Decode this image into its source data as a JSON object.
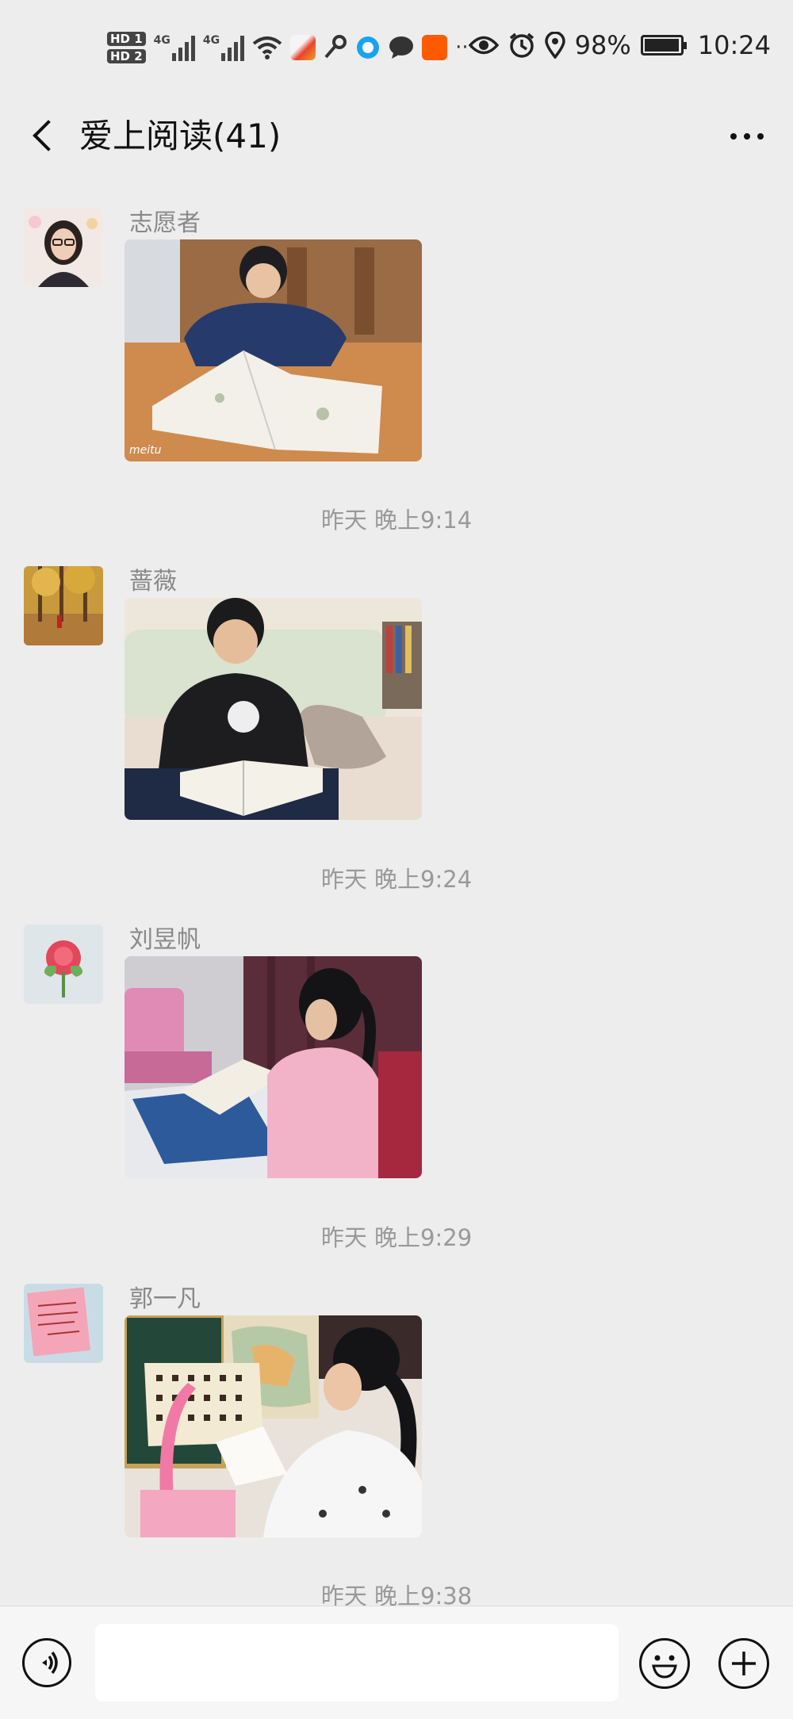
{
  "status": {
    "sim_labels": [
      "HD 1",
      "HD 2"
    ],
    "net_labels": [
      "4G",
      "4G"
    ],
    "notification_more": "···",
    "battery": "98%",
    "battery_level": 0.98,
    "time": "10:24"
  },
  "header": {
    "title": "爱上阅读(41)"
  },
  "messages": [
    {
      "sender": "志愿者",
      "photo_desc": "boy-reading-at-table",
      "timestamp": "昨天 晚上9:14"
    },
    {
      "sender": "蔷薇",
      "photo_desc": "boy-reading-on-sofa",
      "timestamp": "昨天 晚上9:24"
    },
    {
      "sender": "刘昱帆",
      "photo_desc": "girl-reading-at-desk",
      "timestamp": "昨天 晚上9:29"
    },
    {
      "sender": "郭一凡",
      "photo_desc": "girl-reading-near-map",
      "timestamp": "昨天 晚上9:38"
    }
  ],
  "icons": {
    "back": "chevron-left-icon",
    "more": "more-dots-icon",
    "voice": "voice-icon",
    "emoji": "emoji-icon",
    "plus": "plus-icon"
  },
  "colors": {
    "background": "#ededed",
    "sender_text": "#888888",
    "time_text": "#999999"
  }
}
